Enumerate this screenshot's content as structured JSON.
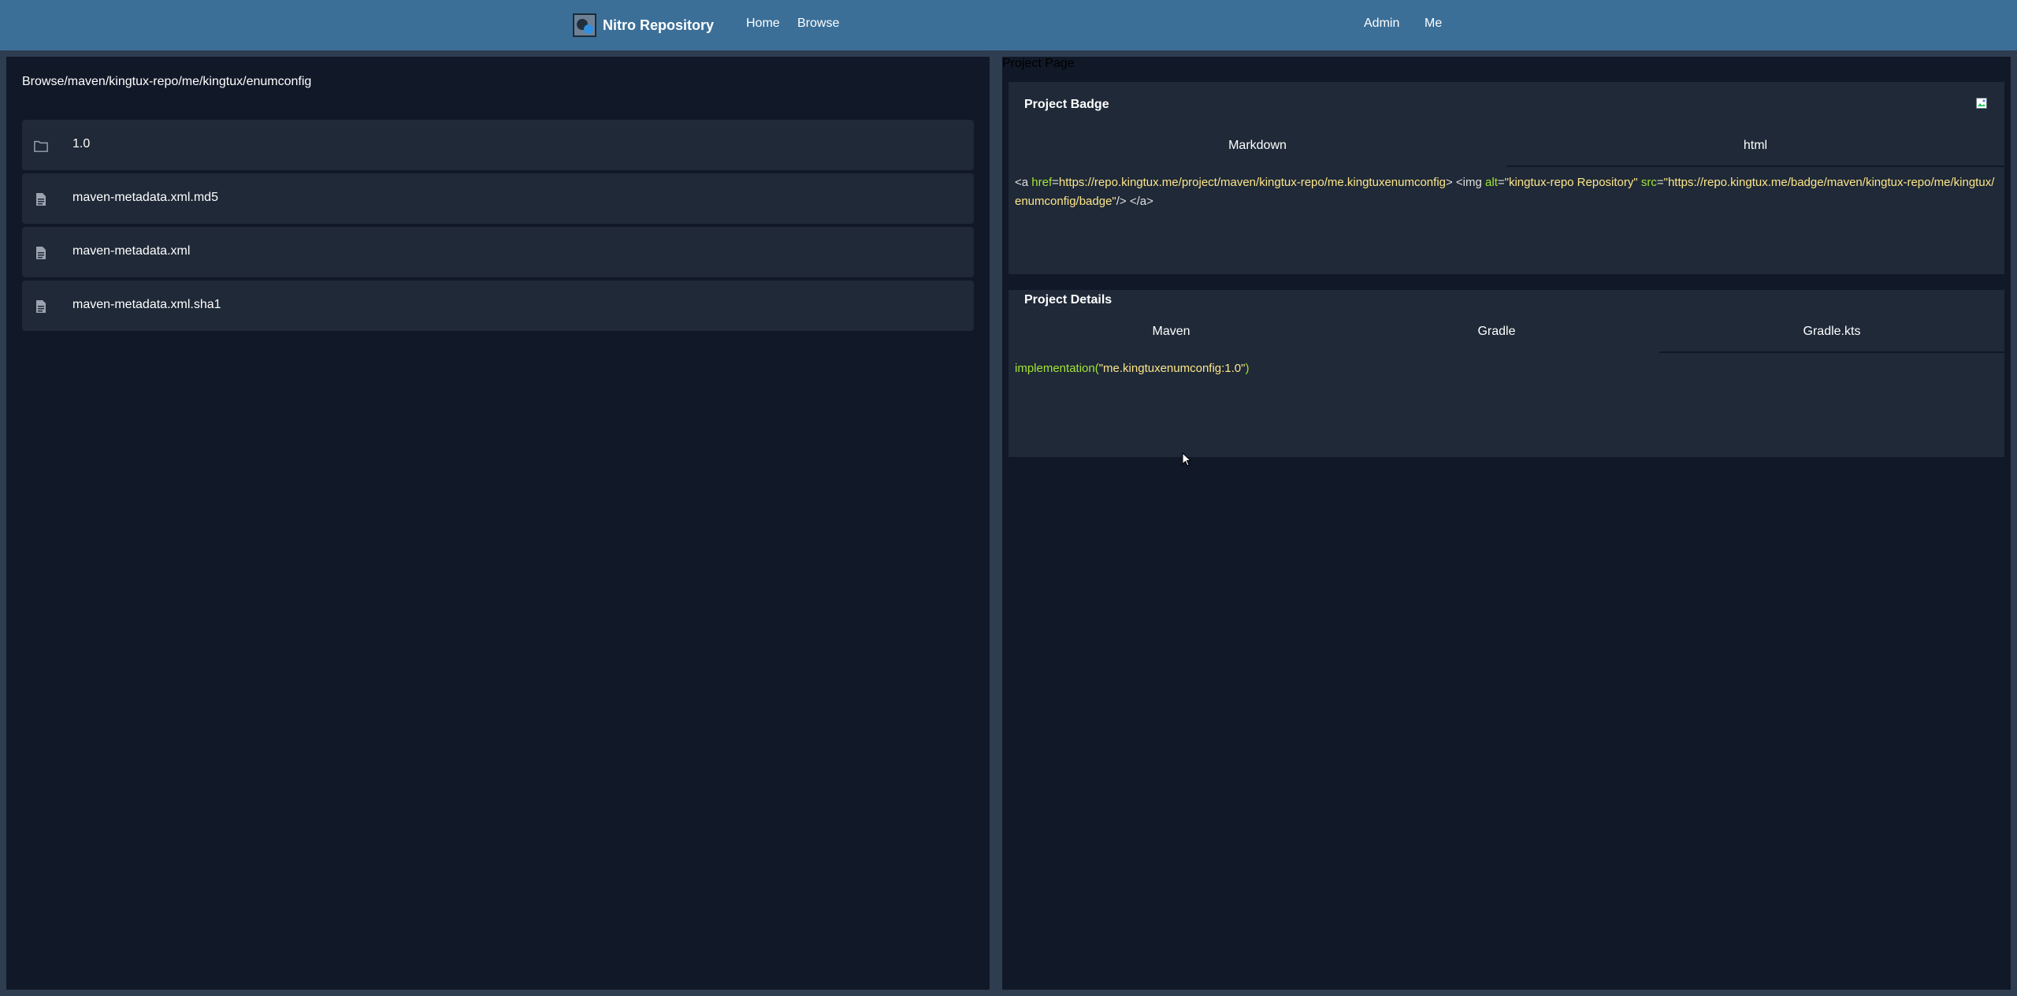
{
  "nav": {
    "brand": "Nitro Repository",
    "links": [
      "Home",
      "Browse"
    ],
    "right_links": [
      "Admin",
      "Me"
    ],
    "logo_icon": "nitro-logo-icon"
  },
  "browser": {
    "breadcrumb": "Browse/maven/kingtux-repo/me/kingtux/enumconfig",
    "items": [
      {
        "name": "1.0",
        "icon": "folder-icon"
      },
      {
        "name": "maven-metadata.xml.md5",
        "icon": "file-icon"
      },
      {
        "name": "maven-metadata.xml",
        "icon": "file-icon"
      },
      {
        "name": "maven-metadata.xml.sha1",
        "icon": "file-icon"
      }
    ]
  },
  "project": {
    "page_title": "Project Page",
    "badge": {
      "title": "Project Badge",
      "tabs": [
        "Markdown",
        "html"
      ],
      "selected_tab": "html",
      "code": {
        "open": "<a ",
        "href_attr": "href",
        "href_value": "https://repo.kingtux.me/project/maven/kingtux-repo/me.kingtuxenumconfig",
        "img_open": "> <img ",
        "alt_attr": "alt",
        "alt_value": "\"kingtux-repo Repository\"",
        "src_attr": " src",
        "src_value": "\"https://repo.kingtux.me/badge/maven/kingtux-repo/me/kingtux/enumconfig/badge\"",
        "close": "/> </a>"
      }
    },
    "details": {
      "title": "Project Details",
      "tabs": [
        "Maven",
        "Gradle",
        "Gradle.kts"
      ],
      "selected_tab": "Gradle.kts",
      "code": {
        "fn": "implementation(",
        "arg": "\"me.kingtuxenumconfig:1.0\"",
        "close": ")"
      }
    }
  },
  "colors": {
    "nav_bg": "#3b6f98",
    "page_bg": "#2e3d4f",
    "panel_bg": "#111827",
    "card_bg": "#1f2937",
    "code_green": "#a3e635",
    "code_yellow": "#fde68a"
  }
}
